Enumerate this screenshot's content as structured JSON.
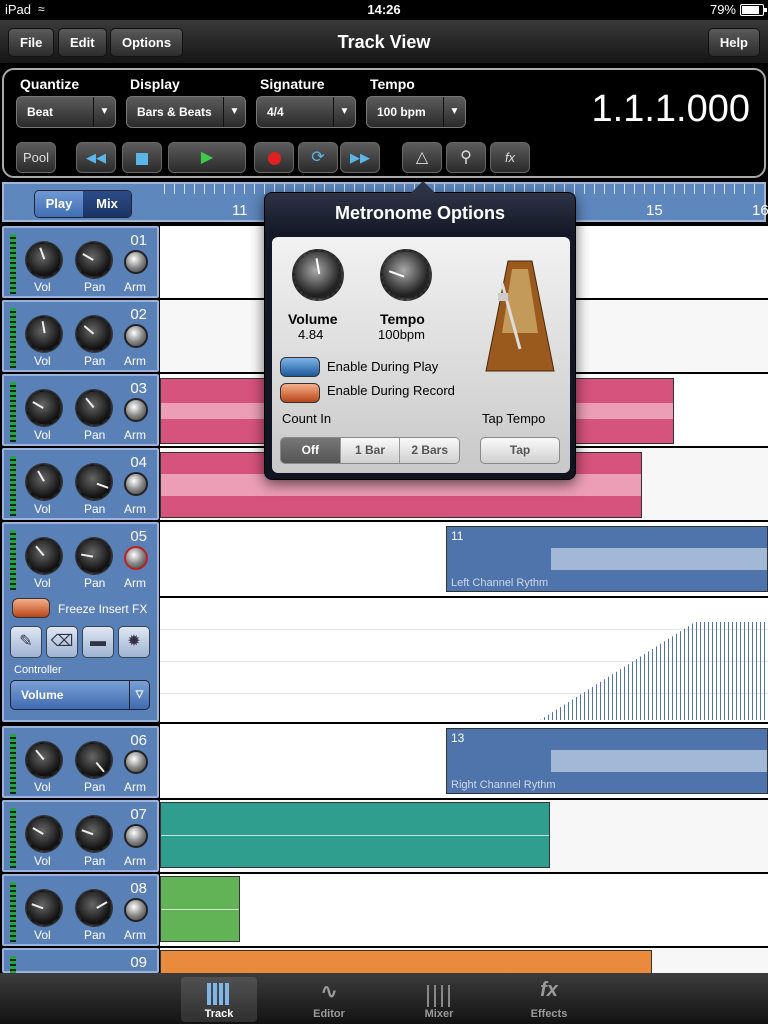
{
  "status": {
    "carrier": "iPad",
    "time": "14:26",
    "battery": "79%"
  },
  "nav": {
    "title": "Track View",
    "file": "File",
    "edit": "Edit",
    "options": "Options",
    "help": "Help"
  },
  "transport": {
    "quantize": {
      "label": "Quantize",
      "value": "Beat"
    },
    "display": {
      "label": "Display",
      "value": "Bars & Beats"
    },
    "signature": {
      "label": "Signature",
      "value": "4/4"
    },
    "tempo": {
      "label": "Tempo",
      "value": "100 bpm"
    },
    "position": "1.1.1.000",
    "pool": "Pool",
    "fx": "fx"
  },
  "ruler": {
    "play": "Play",
    "mix": "Mix",
    "marks": [
      "11",
      "15",
      "16"
    ]
  },
  "tracks": [
    {
      "num": "01",
      "vol": "Vol",
      "pan": "Pan",
      "arm": "Arm"
    },
    {
      "num": "02",
      "vol": "Vol",
      "pan": "Pan",
      "arm": "Arm"
    },
    {
      "num": "03",
      "vol": "Vol",
      "pan": "Pan",
      "arm": "Arm"
    },
    {
      "num": "04",
      "vol": "Vol",
      "pan": "Pan",
      "arm": "Arm"
    },
    {
      "num": "05",
      "vol": "Vol",
      "pan": "Pan",
      "arm": "Arm"
    },
    {
      "num": "06",
      "vol": "Vol",
      "pan": "Pan",
      "arm": "Arm"
    },
    {
      "num": "07",
      "vol": "Vol",
      "pan": "Pan",
      "arm": "Arm"
    },
    {
      "num": "08",
      "vol": "Vol",
      "pan": "Pan",
      "arm": "Arm"
    },
    {
      "num": "09"
    }
  ],
  "track5": {
    "freeze": "Freeze Insert FX",
    "controller": "Controller",
    "controller_value": "Volume"
  },
  "clips": [
    {
      "num": "11",
      "name": "Left Channel Rythm"
    },
    {
      "num": "13",
      "name": "Right Channel Rythm"
    }
  ],
  "popup": {
    "title": "Metronome Options",
    "volume_label": "Volume",
    "volume_value": "4.84",
    "tempo_label": "Tempo",
    "tempo_value": "100bpm",
    "enable_play": "Enable During Play",
    "enable_record": "Enable During Record",
    "count_in": "Count In",
    "count_options": [
      "Off",
      "1 Bar",
      "2 Bars"
    ],
    "tap_tempo": "Tap Tempo",
    "tap": "Tap"
  },
  "tabs": [
    {
      "label": "Track",
      "icon": "track-grid-icon"
    },
    {
      "label": "Editor",
      "icon": "waveform-icon"
    },
    {
      "label": "Mixer",
      "icon": "mixer-sliders-icon"
    },
    {
      "label": "Effects",
      "icon": "fx-icon"
    }
  ],
  "colors": {
    "accent": "#5a80b8",
    "pink_clip": "#d6537e",
    "blue_clip": "#4f74ab",
    "teal_clip": "#2f9e8e",
    "green_clip": "#62b256",
    "orange_clip": "#ea8a3c"
  }
}
